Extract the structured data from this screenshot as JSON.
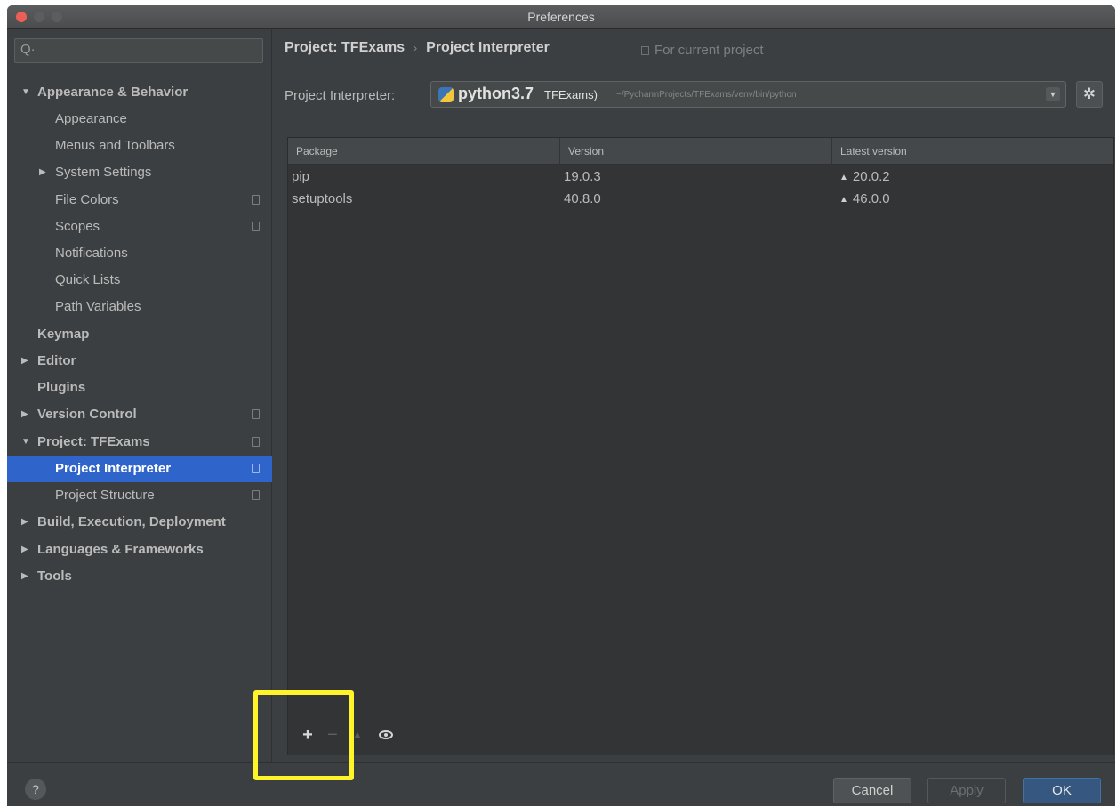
{
  "window": {
    "title": "Preferences"
  },
  "sidebar": {
    "search_placeholder": "Q·",
    "items": [
      {
        "label": "Appearance & Behavior",
        "expanded": true
      },
      {
        "label": "Appearance"
      },
      {
        "label": "Menus and Toolbars"
      },
      {
        "label": "System Settings",
        "expanded": false
      },
      {
        "label": "File Colors"
      },
      {
        "label": "Scopes"
      },
      {
        "label": "Notifications"
      },
      {
        "label": "Quick Lists"
      },
      {
        "label": "Path Variables"
      },
      {
        "label": "Keymap"
      },
      {
        "label": "Editor",
        "expanded": false
      },
      {
        "label": "Plugins"
      },
      {
        "label": "Version Control",
        "expanded": false
      },
      {
        "label": "Project: TFExams",
        "expanded": true
      },
      {
        "label": "Project Interpreter",
        "selected": true
      },
      {
        "label": "Project Structure"
      },
      {
        "label": "Build, Execution, Deployment",
        "expanded": false
      },
      {
        "label": "Languages & Frameworks",
        "expanded": false
      },
      {
        "label": "Tools",
        "expanded": false
      }
    ]
  },
  "breadcrumb": {
    "parent": "Project: TFExams",
    "current": "Project Interpreter",
    "scope_note": "For current project"
  },
  "interpreter": {
    "label": "Project Interpreter:",
    "name": "python3.7",
    "env": "TFExams)",
    "path": "~/PycharmProjects/TFExams/venv/bin/python"
  },
  "packages_table": {
    "columns": [
      "Package",
      "Version",
      "Latest version"
    ],
    "rows": [
      {
        "package": "pip",
        "version": "19.0.3",
        "latest": "20.0.2"
      },
      {
        "package": "setuptools",
        "version": "40.8.0",
        "latest": "46.0.0"
      }
    ]
  },
  "toolbar": {
    "add": "+",
    "remove": "−",
    "upgrade": "▲"
  },
  "icons": {
    "gear": "gear-icon",
    "eye": "eye-icon",
    "upgrade": "upgrade-arrow-icon",
    "help": "?"
  },
  "buttons": {
    "cancel": "Cancel",
    "apply": "Apply",
    "ok": "OK"
  },
  "colors": {
    "selection": "#2f65ca",
    "highlight_box": "#fff42a",
    "ok_button": "#365880"
  }
}
